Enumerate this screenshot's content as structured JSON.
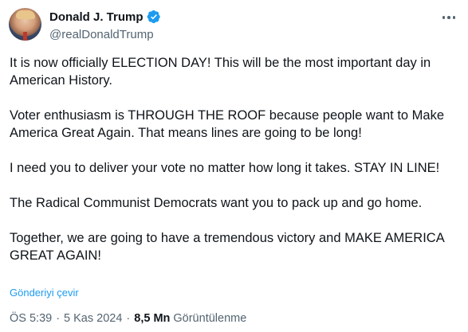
{
  "author": {
    "display_name": "Donald J. Trump",
    "handle": "@realDonaldTrump",
    "verified": true,
    "verified_color": "#1d9bf0"
  },
  "tweet": {
    "paragraphs": [
      "It is now officially ELECTION DAY! This will be the most important day in American History.",
      "Voter enthusiasm is THROUGH THE ROOF because people want to Make America Great Again. That means lines are going to be long!",
      "I need you to deliver your vote no matter how long it takes. STAY IN LINE!",
      "The Radical Communist Democrats want you to pack up and go home.",
      "Together, we are going to have a tremendous victory and MAKE AMERICA GREAT AGAIN!"
    ],
    "translate_label": "Gönderiyi çevir"
  },
  "meta": {
    "time": "ÖS 5:39",
    "separator": "·",
    "date": "5 Kas 2024",
    "views_count": "8,5 Mn",
    "views_label": "Görüntülenme"
  },
  "icons": {
    "avatar": "profile-photo",
    "verified": "verified-badge-icon",
    "more": "more-options-icon"
  },
  "colors": {
    "link": "#1d9bf0",
    "secondary_text": "#536471",
    "primary_text": "#0f1419"
  }
}
